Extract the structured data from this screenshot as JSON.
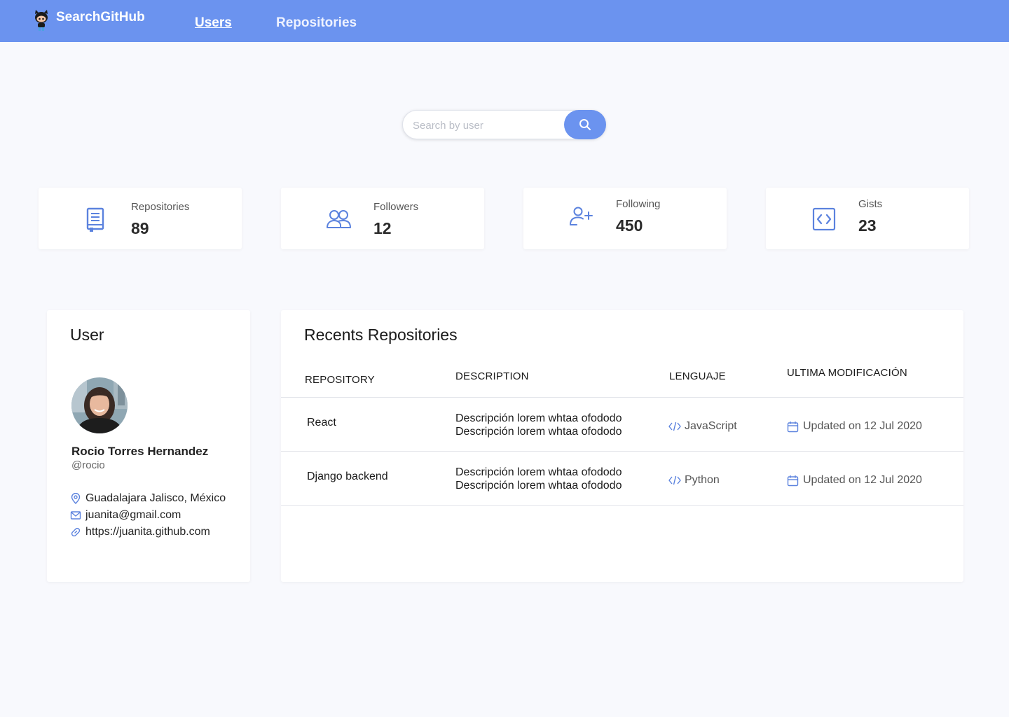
{
  "header": {
    "brand": "SearchGitHub",
    "nav": [
      {
        "label": "Users"
      },
      {
        "label": "Repositories"
      }
    ]
  },
  "search": {
    "placeholder": "Search by user",
    "value": ""
  },
  "stats": [
    {
      "label": "Repositories",
      "value": "89",
      "icon": "repo-book-icon"
    },
    {
      "label": "Followers",
      "value": "12",
      "icon": "followers-icon"
    },
    {
      "label": "Following",
      "value": "450",
      "icon": "user-plus-icon"
    },
    {
      "label": "Gists",
      "value": "23",
      "icon": "code-icon"
    }
  ],
  "user": {
    "title": "User",
    "name": "Rocio Torres Hernandez",
    "handle": "@rocio",
    "location": "Guadalajara Jalisco, México",
    "email": "juanita@gmail.com",
    "website": "https://juanita.github.com"
  },
  "repos": {
    "title": "Recents Repositories",
    "columns": [
      "REPOSITORY",
      "DESCRIPTION",
      "LENGUAJE",
      "ULTIMA MODIFICACIÓN"
    ],
    "rows": [
      {
        "name": "React",
        "desc_line1": "Descripción lorem whtaa ofododo",
        "desc_line2": "Descripción lorem whtaa ofododo",
        "language": "JavaScript",
        "updated": "Updated on 12 Jul 2020"
      },
      {
        "name": "Django backend",
        "desc_line1": "Descripción lorem whtaa ofododo",
        "desc_line2": "Descripción lorem whtaa ofododo",
        "language": "Python",
        "updated": "Updated on 12 Jul 2020"
      }
    ]
  },
  "colors": {
    "accent": "#6b93ef",
    "background": "#f8f9fd"
  }
}
